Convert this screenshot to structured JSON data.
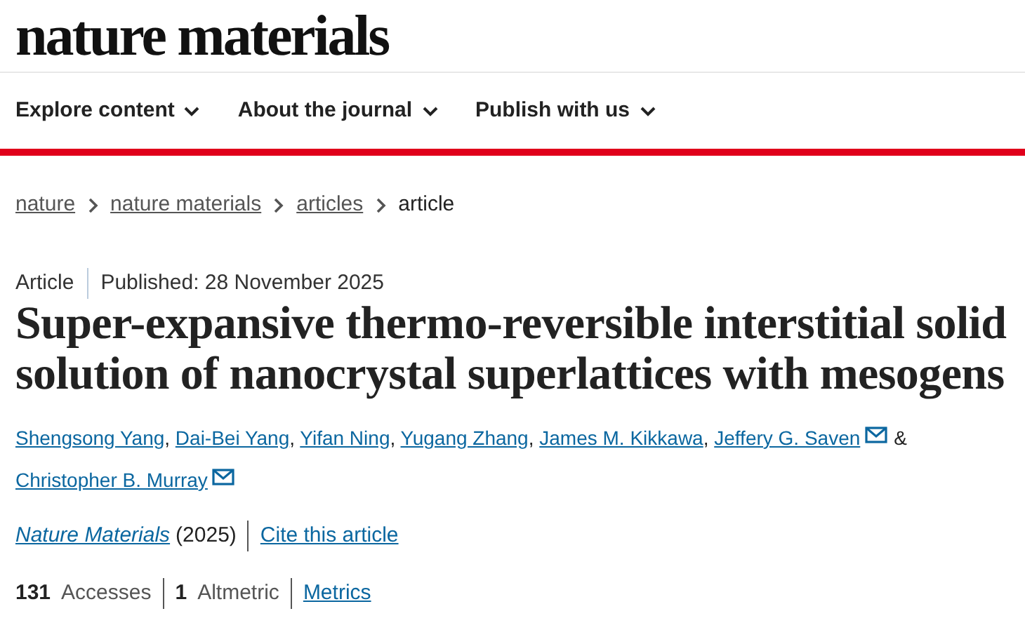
{
  "logo": "nature materials",
  "nav": [
    {
      "label": "Explore content"
    },
    {
      "label": "About the journal"
    },
    {
      "label": "Publish with us"
    }
  ],
  "breadcrumb": [
    {
      "label": "nature",
      "link": true
    },
    {
      "label": "nature materials",
      "link": true
    },
    {
      "label": "articles",
      "link": true
    },
    {
      "label": "article",
      "link": false
    }
  ],
  "article_type": "Article",
  "published": "Published: 28 November 2025",
  "title": "Super-expansive thermo-reversible interstitial solid solution of nanocrystal superlattices with mesogens",
  "authors": [
    {
      "name": "Shengsong Yang",
      "email": false,
      "after": ","
    },
    {
      "name": "Dai-Bei Yang",
      "email": false,
      "after": ","
    },
    {
      "name": "Yifan Ning",
      "email": false,
      "after": ","
    },
    {
      "name": "Yugang Zhang",
      "email": false,
      "after": ","
    },
    {
      "name": "James M. Kikkawa",
      "email": false,
      "after": ","
    },
    {
      "name": "Jeffery G. Saven",
      "email": true,
      "after": "&"
    },
    {
      "name": "Christopher B. Murray",
      "email": true
    }
  ],
  "journal": "Nature Materials",
  "year": "(2025)",
  "cite": "Cite this article",
  "metrics": [
    {
      "text": "**131** Accesses",
      "kind": "count"
    },
    {
      "text": "**1** Altmetric",
      "kind": "count"
    },
    {
      "text": "Metrics",
      "kind": "link"
    }
  ]
}
